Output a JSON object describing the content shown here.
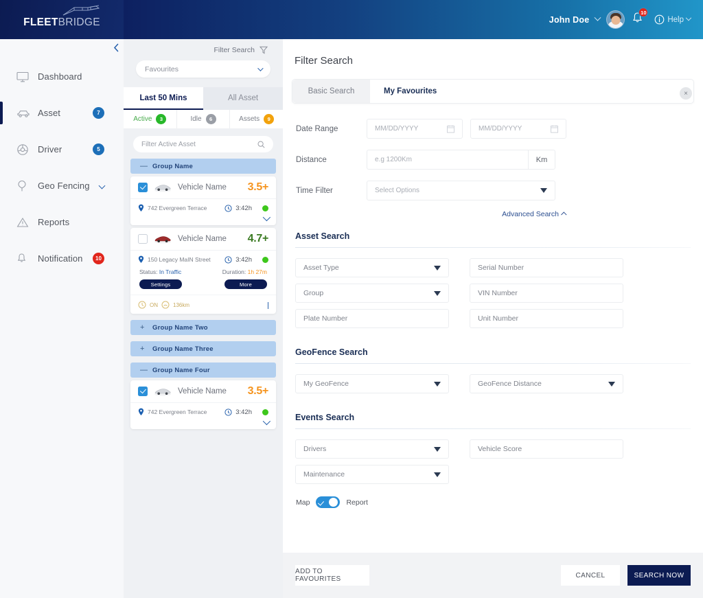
{
  "brand": {
    "fleet": "FLEET",
    "bridge": "BRIDGE"
  },
  "header": {
    "user_name": "John Doe",
    "notification_count": "10",
    "help_label": "Help"
  },
  "sidebar": {
    "items": [
      {
        "label": "Dashboard",
        "icon": "monitor-icon",
        "badge": null
      },
      {
        "label": "Asset",
        "icon": "car-icon",
        "badge": "7"
      },
      {
        "label": "Driver",
        "icon": "steering-wheel-icon",
        "badge": "5"
      },
      {
        "label": "Geo Fencing",
        "icon": "pin-icon",
        "badge": null
      },
      {
        "label": "Reports",
        "icon": "triangle-alert-icon",
        "badge": null
      },
      {
        "label": "Notification",
        "icon": "bell-icon",
        "badge": "10"
      }
    ]
  },
  "asset_panel": {
    "filter_label": "Filter Search",
    "favourites_select": "Favourites",
    "tabs": [
      {
        "label": "Last 50 Mins",
        "active": true
      },
      {
        "label": "All Asset",
        "active": false
      }
    ],
    "stats": [
      {
        "label": "Active",
        "count": "3",
        "color": "#28b82a"
      },
      {
        "label": "Idle",
        "count": "6",
        "color": "#9a9ea6"
      },
      {
        "label": "Assets",
        "count": "9",
        "color": "#f2a20c"
      }
    ],
    "search_placeholder": "Filter  Active Asset",
    "groups": [
      {
        "name": "Group Name",
        "sign": "—"
      },
      {
        "name": "Group Name Two",
        "sign": "+"
      },
      {
        "name": "Group Name Three",
        "sign": "+"
      },
      {
        "name": "Group Name Four",
        "sign": "—"
      }
    ],
    "vehicles": [
      {
        "name": "Vehicle Name",
        "score": "3.5+",
        "score_color": "#f5941f",
        "address": "742 Evergreen Terrace",
        "time": "3:42h",
        "checked": true,
        "expanded": false
      },
      {
        "name": "Vehicle Name",
        "score": "4.7+",
        "score_color": "#3b7a22",
        "address": "150 Legacy MaIN Street",
        "time": "3:42h",
        "checked": false,
        "expanded": true,
        "status_label": "Status:",
        "status_value": "In Traffic",
        "duration_label": "Duration:",
        "duration_value": "1h 27m",
        "settings_button": "Settings",
        "more_button": "More",
        "ignition": "ON",
        "distance": "136km"
      },
      {
        "name": "Vehicle Name",
        "score": "3.5+",
        "score_color": "#f5941f",
        "address": "742 Evergreen Terrace",
        "time": "3:42h",
        "checked": true,
        "expanded": false
      }
    ]
  },
  "main": {
    "title": "Filter Search",
    "close_icon": "×",
    "tabs": [
      {
        "label": "Basic Search",
        "active": false
      },
      {
        "label": "My Favourites",
        "active": true
      }
    ],
    "basic": {
      "date_range_label": "Date Range",
      "date_from_placeholder": "MM/DD/YYYY",
      "date_to_placeholder": "MM/DD/YYYY",
      "distance_label": "Distance",
      "distance_placeholder": "e.g 1200Km",
      "distance_unit": "Km",
      "time_filter_label": "Time Filter",
      "time_filter_placeholder": "Select Options",
      "advanced_link": "Advanced Search"
    },
    "asset_search": {
      "title": "Asset Search",
      "fields": [
        {
          "label": "Asset Type",
          "type": "select"
        },
        {
          "label": "Serial Number",
          "type": "input"
        },
        {
          "label": "Group",
          "type": "select"
        },
        {
          "label": "VIN Number",
          "type": "input"
        },
        {
          "label": "Plate Number",
          "type": "input"
        },
        {
          "label": "Unit Number",
          "type": "input"
        }
      ]
    },
    "geofence_search": {
      "title": "GeoFence Search",
      "fields": [
        {
          "label": "My GeoFence",
          "type": "select"
        },
        {
          "label": "GeoFence Distance",
          "type": "select"
        }
      ]
    },
    "events_search": {
      "title": "Events Search",
      "fields": [
        {
          "label": "Drivers",
          "type": "select"
        },
        {
          "label": "Vehicle Score",
          "type": "input"
        },
        {
          "label": "Maintenance",
          "type": "select"
        }
      ]
    },
    "toggle": {
      "left_label": "Map",
      "right_label": "Report",
      "on": true
    },
    "footer": {
      "add_favourites": "ADD TO FAVOURITES",
      "cancel": "CANCEL",
      "search_now": "SEARCH NOW"
    }
  }
}
